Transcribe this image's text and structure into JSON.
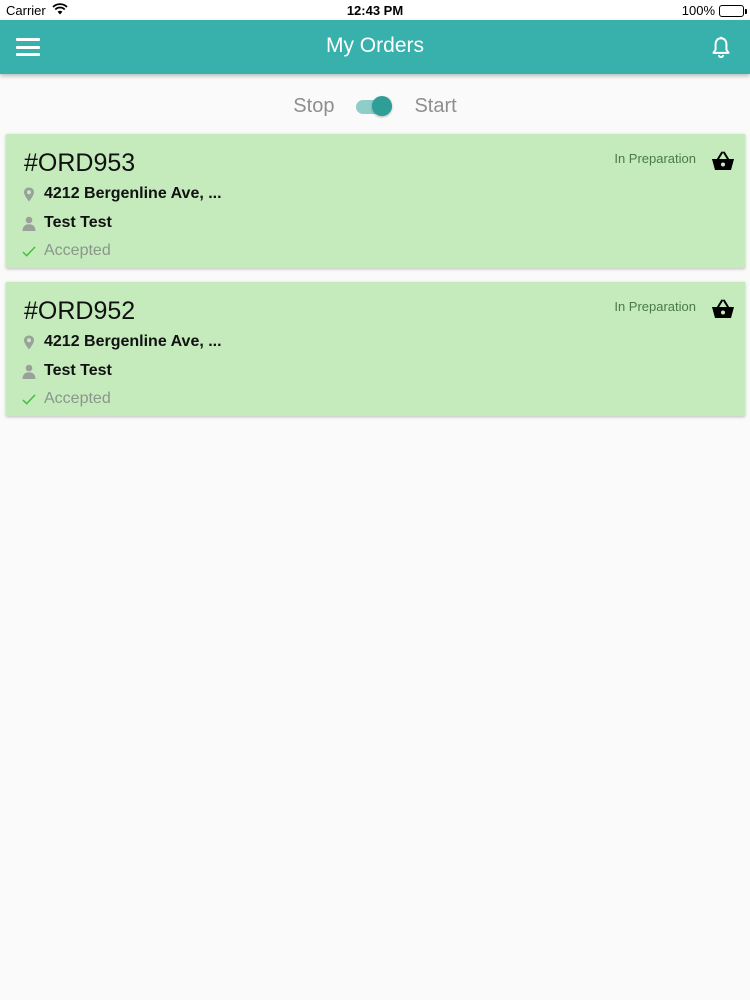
{
  "status_bar": {
    "carrier": "Carrier",
    "time": "12:43 PM",
    "battery": "100%",
    "battery_level_percent": 100
  },
  "app_bar": {
    "title": "My Orders",
    "menu_icon": "hamburger-icon",
    "notification_icon": "bell-icon"
  },
  "availability_toggle": {
    "off_label": "Stop",
    "on_label": "Start",
    "is_on": true
  },
  "orders": [
    {
      "id": "#ORD953",
      "status": "In Preparation",
      "address": "4212 Bergenline Ave, ...",
      "customer": "Test Test",
      "state": "Accepted"
    },
    {
      "id": "#ORD952",
      "status": "In Preparation",
      "address": "4212 Bergenline Ave, ...",
      "customer": "Test Test",
      "state": "Accepted"
    }
  ],
  "colors": {
    "app_bar": "#38b0ab",
    "card_background": "#c5ebbd",
    "toggle_accent": "#2e9e97",
    "check_green": "#3ec13e"
  }
}
